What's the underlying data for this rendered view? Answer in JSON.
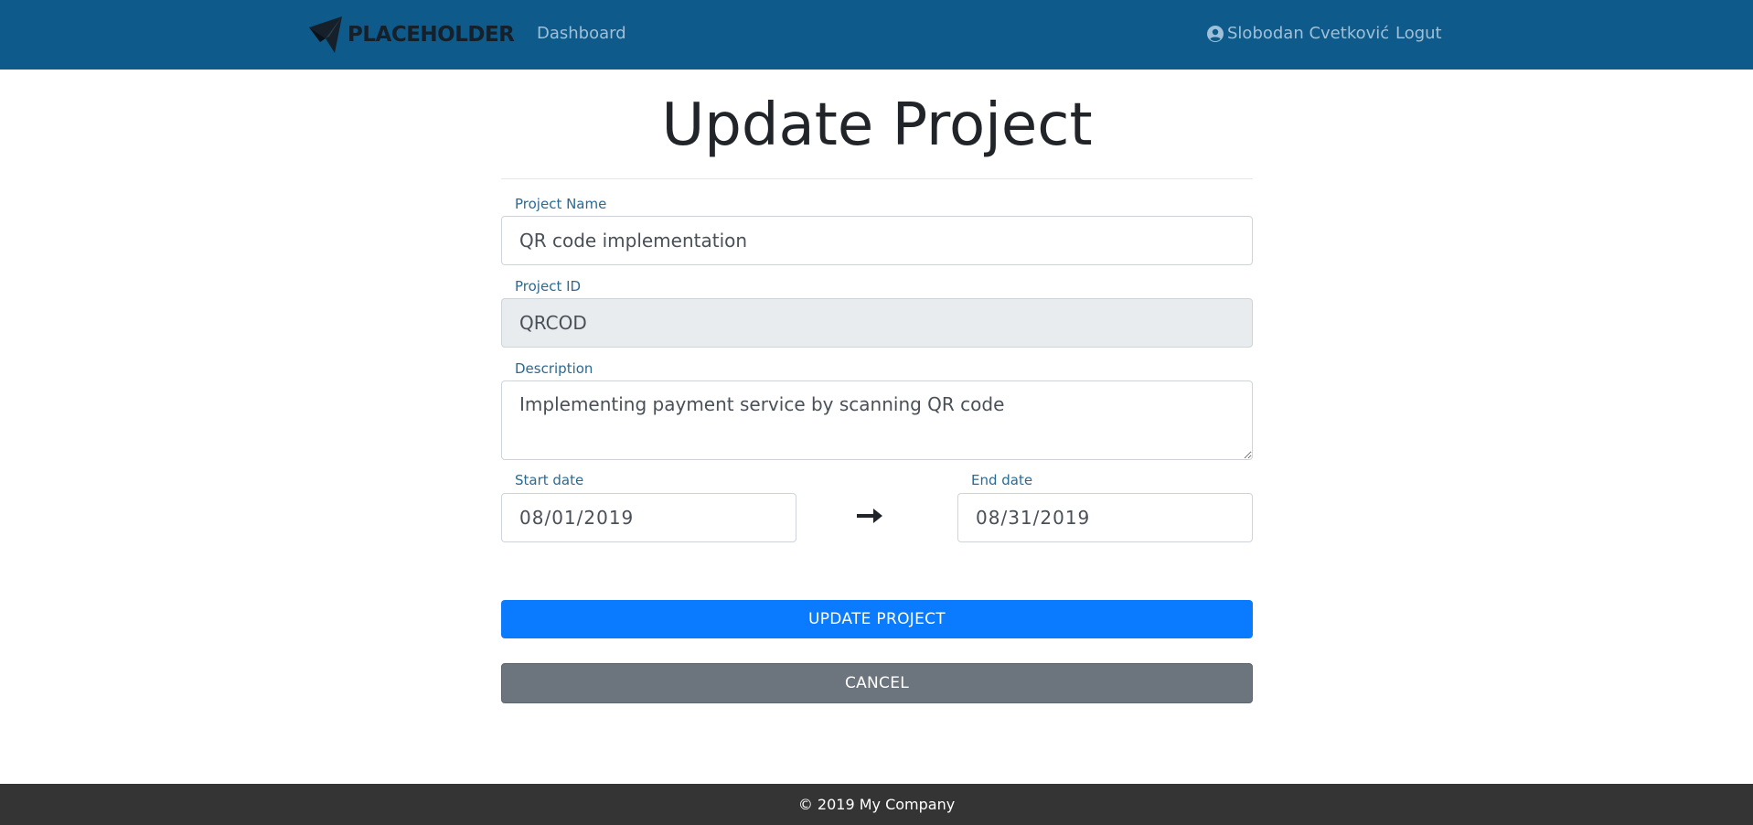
{
  "navbar": {
    "brand": "PLACEHOLDER",
    "dashboard": "Dashboard",
    "user_name": "Slobodan Cvetković",
    "logout": "Logut"
  },
  "page": {
    "title": "Update Project"
  },
  "form": {
    "project_name_label": "Project Name",
    "project_name_value": "QR code implementation",
    "project_id_label": "Project ID",
    "project_id_value": "QRCOD",
    "description_label": "Description",
    "description_value": "Implementing payment service by scanning QR code",
    "start_date_label": "Start date",
    "start_date_value": "08/01/2019",
    "end_date_label": "End date",
    "end_date_value": "08/31/2019",
    "update_button": "UPDATE PROJECT",
    "cancel_button": "CANCEL"
  },
  "footer": {
    "copyright": "© 2019 My Company"
  },
  "colors": {
    "navbar": "#0e5a8a",
    "primary_button": "#0a7bff",
    "secondary_button": "#6c747e",
    "footer": "#343434"
  },
  "icons": {
    "brand": "paper-plane-logo-icon",
    "user": "user-circle-icon",
    "date_range": "arrow-right-icon"
  }
}
